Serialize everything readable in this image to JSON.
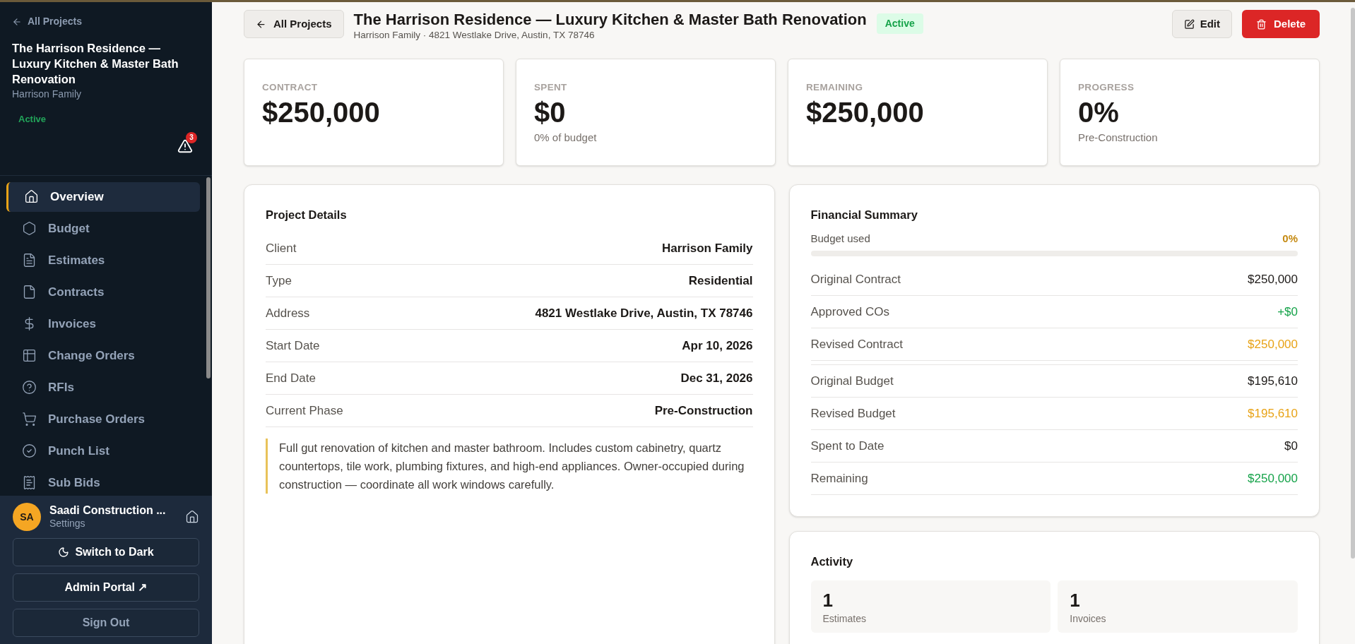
{
  "sidebar": {
    "back_link": "All Projects",
    "project_title": "The Harrison Residence — Luxury Kitchen & Master Bath Renovation",
    "client": "Harrison Family",
    "status": "Active",
    "alert_count": "3",
    "nav": [
      {
        "label": "Overview",
        "selected": true
      },
      {
        "label": "Budget",
        "selected": false
      },
      {
        "label": "Estimates",
        "selected": false
      },
      {
        "label": "Contracts",
        "selected": false
      },
      {
        "label": "Invoices",
        "selected": false
      },
      {
        "label": "Change Orders",
        "selected": false
      },
      {
        "label": "RFIs",
        "selected": false
      },
      {
        "label": "Purchase Orders",
        "selected": false
      },
      {
        "label": "Punch List",
        "selected": false
      },
      {
        "label": "Sub Bids",
        "selected": false
      }
    ],
    "account": {
      "initials": "SA",
      "name": "Saadi Construction ...",
      "subtitle": "Settings"
    },
    "buttons": [
      {
        "label": "Switch to Dark",
        "kind": "theme"
      },
      {
        "label": "Admin Portal ↗",
        "kind": "primary"
      },
      {
        "label": "Sign Out",
        "kind": "muted"
      }
    ]
  },
  "header": {
    "back_button": "All Projects",
    "title": "The Harrison Residence — Luxury Kitchen & Master Bath Renovation",
    "subtitle": "Harrison Family · 4821 Westlake Drive, Austin, TX 78746",
    "status": "Active",
    "edit": "Edit",
    "delete": "Delete"
  },
  "stats": [
    {
      "label": "CONTRACT",
      "value": "$250,000"
    },
    {
      "label": "SPENT",
      "value": "$0",
      "note": "0% of budget"
    },
    {
      "label": "REMAINING",
      "value": "$250,000"
    },
    {
      "label": "PROGRESS",
      "value": "0%",
      "note": "Pre-Construction"
    }
  ],
  "project_details": {
    "title": "Project Details",
    "rows": [
      {
        "label": "Client",
        "value": "Harrison Family"
      },
      {
        "label": "Type",
        "value": "Residential"
      },
      {
        "label": "Address",
        "value": "4821 Westlake Drive, Austin, TX 78746"
      },
      {
        "label": "Start Date",
        "value": "Apr 10, 2026"
      },
      {
        "label": "End Date",
        "value": "Dec 31, 2026"
      },
      {
        "label": "Current Phase",
        "value": "Pre-Construction"
      }
    ],
    "description": "Full gut renovation of kitchen and master bathroom. Includes custom cabinetry, quartz countertops, tile work, plumbing fixtures, and high-end appliances. Owner-occupied during construction — coordinate all work windows carefully."
  },
  "financial_summary": {
    "title": "Financial Summary",
    "budget_used": {
      "label": "Budget used",
      "reading": "0%",
      "level": 0
    },
    "contract_rows": [
      {
        "label": "Original Contract",
        "value": "$250,000",
        "color": "#1c1917"
      },
      {
        "label": "Approved COs",
        "value": "+$0",
        "color": "#16a34a"
      },
      {
        "label": "Revised Contract",
        "value": "$250,000",
        "color": "#e8a317"
      }
    ],
    "budget_rows": [
      {
        "label": "Original Budget",
        "value": "$195,610",
        "color": "#1c1917"
      },
      {
        "label": "Revised Budget",
        "value": "$195,610",
        "color": "#e8a317"
      },
      {
        "label": "Spent to Date",
        "value": "$0",
        "color": "#1c1917"
      },
      {
        "label": "Remaining",
        "value": "$250,000",
        "color": "#16a34a"
      }
    ]
  },
  "activity": {
    "title": "Activity",
    "tiles": [
      {
        "count": "1",
        "label": "Estimates"
      },
      {
        "count": "1",
        "label": "Invoices"
      }
    ]
  }
}
